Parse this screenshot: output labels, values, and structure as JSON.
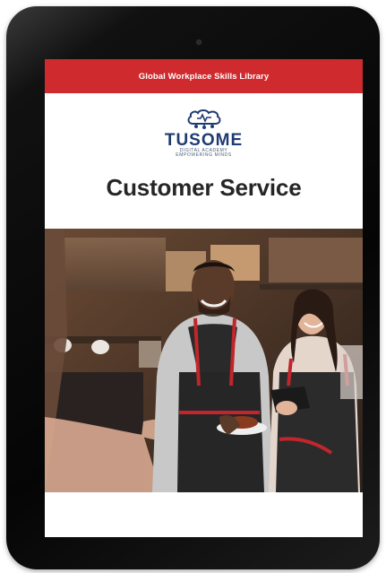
{
  "banner": {
    "text": "Global Workplace Skills Library"
  },
  "logo": {
    "name": "TUSOME",
    "tagline_line1": "DIGITAL ACADEMY",
    "tagline_line2": "EMPOWERING MINDS"
  },
  "book": {
    "title": "Customer Service"
  },
  "colors": {
    "banner": "#cf2a2e",
    "logo_blue": "#1f3b73",
    "title": "#262626",
    "bezel": "#0a0a0a"
  },
  "icons": [
    "brain-icon",
    "camera-icon"
  ]
}
